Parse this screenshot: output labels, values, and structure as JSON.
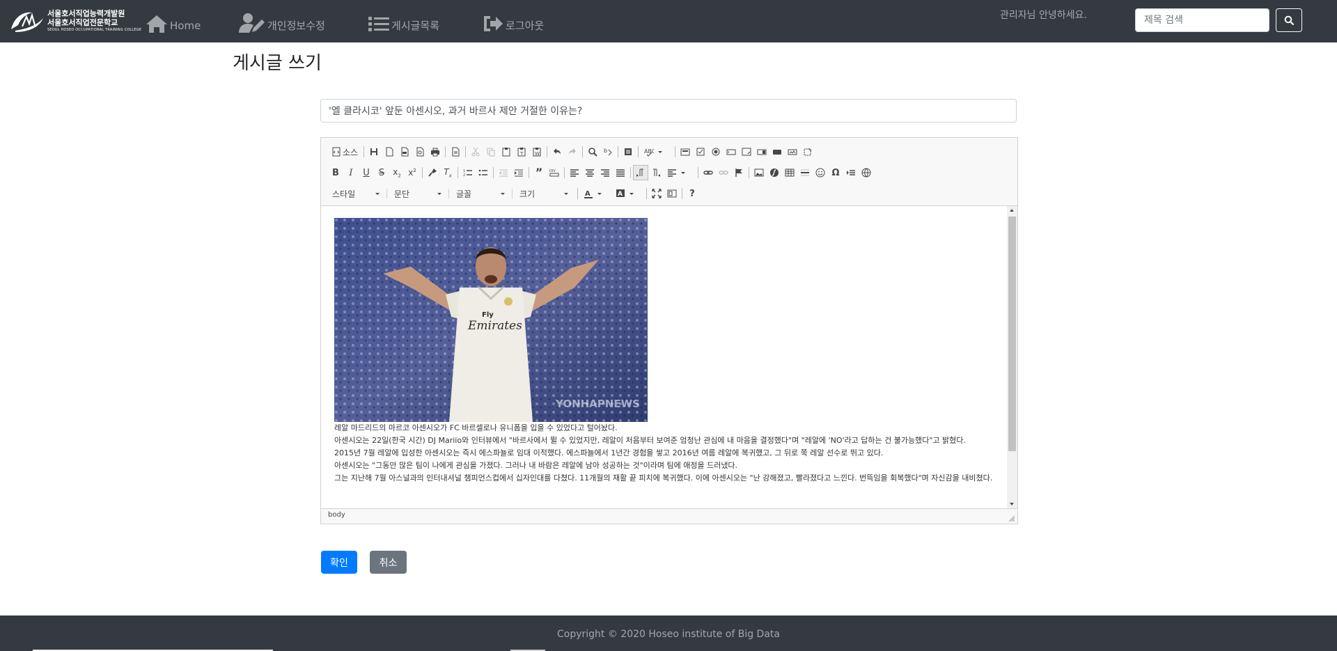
{
  "header": {
    "logo": {
      "line1": "서울호서직업능력개발원",
      "line2": "서울호서직업전문학교",
      "line3": "SEOUL HOSEO OCCUPATIONAL TRAINING COLLEGE"
    },
    "nav": [
      {
        "label": "Home",
        "icon": "home-icon"
      },
      {
        "label": "개인정보수정",
        "icon": "user-edit-icon"
      },
      {
        "label": "게시글목록",
        "icon": "list-icon"
      },
      {
        "label": "로그아웃",
        "icon": "sign-out-icon"
      }
    ],
    "greeting": "관리자님 안녕하세요.",
    "search": {
      "placeholder": "제목 검색",
      "value": "",
      "icon": "search-icon"
    }
  },
  "page": {
    "title": "게시글 쓰기",
    "post_title_value": "'엘 클라시코' 앞둔 아센시오, 과거 바르사 제안 거절한 이유는?"
  },
  "editor": {
    "toolbar": {
      "source_label": "소스",
      "format_combos": [
        {
          "label": "스타일"
        },
        {
          "label": "문단"
        },
        {
          "label": "글꼴"
        },
        {
          "label": "크기"
        }
      ]
    },
    "image_watermark": "YONHAPNEWS",
    "content_lines": [
      "레알 마드리드의 마르코 아센시오가 FC 바르셀로나 유니폼을 입을 수 있었다고 털어놨다.",
      "아센시오는 22일(한국 시간) DJ Mariio와 인터뷰에서 \"바르사에서 뛸 수 있었지만, 레알이 처음부터 보여준 엄청난 관심에 내 마음을 결정했다\"며 \"레알에 'NO'라고 답하는 건 불가능했다\"고 밝혔다.",
      "2015년 7월 레알에 입성한 아센시오는 즉시 에스파뇰로 임대 이적했다. 에스파뇰에서 1년간 경험을 쌓고 2016년 여름 레알에 복귀했고, 그 뒤로 쭉 레알 선수로 뛰고 있다.",
      "아센시오는 \"그동안 많은 팀이 나에게 관심을 가졌다. 그러나 내 바람은 레알에 남아 성공하는 것\"이라며 팀에 애정을 드러냈다.",
      "그는 지난해 7월 아스널과의 인터내셔널 챔피언스컵에서 십자인대를 다쳤다. 11개월의 재활 끝 피치에 복귀했다. 이에 아센시오는 \"난 강해졌고, 빨라졌다고 느낀다. 번뜩임을 회복했다\"며 자신감을 내비쳤다."
    ],
    "status_path": "body"
  },
  "actions": {
    "confirm": "확인",
    "cancel": "취소"
  },
  "footer": {
    "copyright": "Copyright © 2020 Hoseo institute of Big Data"
  },
  "colors": {
    "navbar": "#343a40",
    "primary": "#007bff",
    "secondary": "#6c757d"
  }
}
